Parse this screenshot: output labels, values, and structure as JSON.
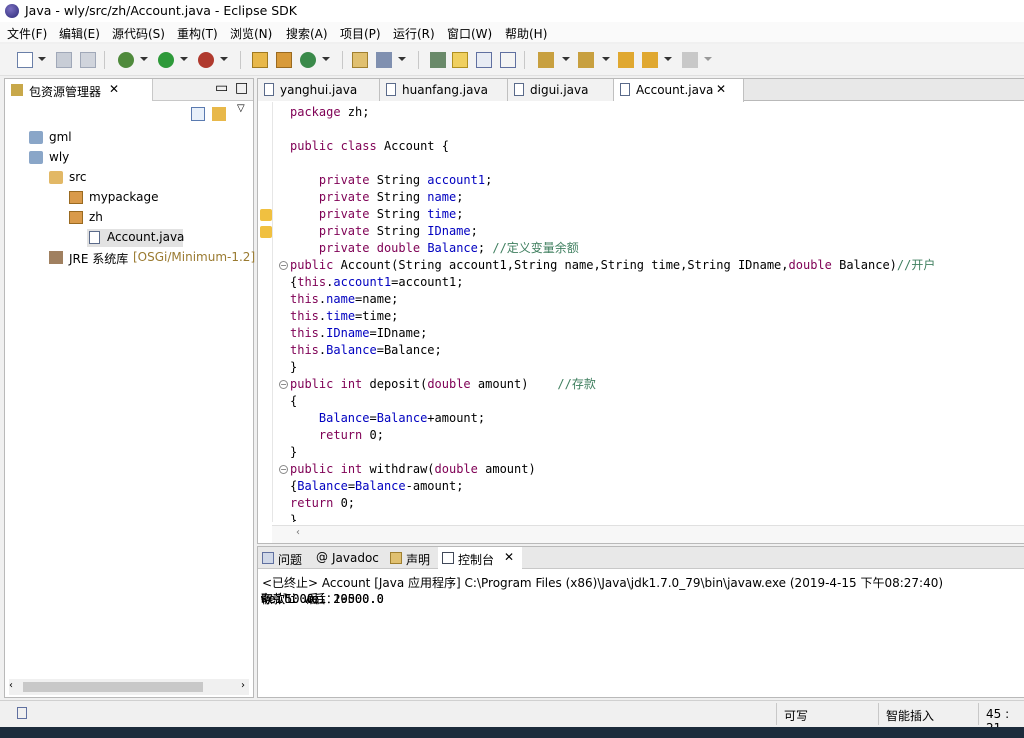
{
  "window": {
    "title": "Java  -  wly/src/zh/Account.java  -  Eclipse SDK"
  },
  "menubar": {
    "items": [
      "文件(F)",
      "编辑(E)",
      "源代码(S)",
      "重构(T)",
      "浏览(N)",
      "搜索(A)",
      "项目(P)",
      "运行(R)",
      "窗口(W)",
      "帮助(H)"
    ]
  },
  "explorer": {
    "title": "包资源管理器",
    "tree": [
      {
        "label": "gml",
        "icon": "project-icon"
      },
      {
        "label": "wly",
        "icon": "project-icon"
      },
      {
        "label": "src",
        "icon": "source-folder-icon"
      },
      {
        "label": "mypackage",
        "icon": "package-icon"
      },
      {
        "label": "zh",
        "icon": "package-icon"
      },
      {
        "label": "Account.java",
        "icon": "java-file-icon"
      },
      {
        "label": "JRE 系统库",
        "suffix": "[OSGi/Minimum-1.2]",
        "icon": "library-icon"
      }
    ]
  },
  "editor": {
    "tabs": [
      "yanghui.java",
      "huanfang.java",
      "digui.java",
      "Account.java"
    ],
    "active_tab": "Account.java"
  },
  "console": {
    "tabs": [
      "问题",
      "Javadoc",
      "声明",
      "控制台"
    ],
    "active_tab": "控制台",
    "description": "<已终止> Account [Java 应用程序] C:\\Program Files (x86)\\Java\\jdk1.7.0_79\\bin\\javaw.exe  (2019-4-15 下午08:27:40)",
    "output": [
      "weili wei 20000.0",
      "存款500后：",
      "weili wei 20500.0",
      "取款1000后：",
      "weili wei 19500.0"
    ]
  },
  "status": {
    "writable": "可写",
    "insert_mode": "智能插入",
    "position": "45 : 21"
  }
}
